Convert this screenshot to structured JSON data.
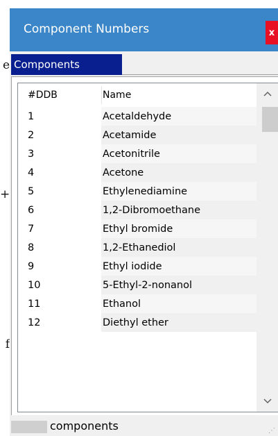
{
  "background_fragments": [
    "e",
    "+",
    "f"
  ],
  "window": {
    "title": "Component Numbers",
    "close_label": "x"
  },
  "tabs": [
    {
      "label": "Components",
      "selected": true
    }
  ],
  "table": {
    "columns": [
      "#DDB",
      "Name"
    ],
    "rows": [
      {
        "ddb": "1",
        "name": "Acetaldehyde"
      },
      {
        "ddb": "2",
        "name": "Acetamide"
      },
      {
        "ddb": "3",
        "name": "Acetonitrile"
      },
      {
        "ddb": "4",
        "name": "Acetone"
      },
      {
        "ddb": "5",
        "name": "Ethylenediamine"
      },
      {
        "ddb": "6",
        "name": "1,2-Dibromoethane"
      },
      {
        "ddb": "7",
        "name": "Ethyl bromide"
      },
      {
        "ddb": "8",
        "name": "1,2-Ethanediol"
      },
      {
        "ddb": "9",
        "name": "Ethyl iodide"
      },
      {
        "ddb": "10",
        "name": "5-Ethyl-2-nonanol"
      },
      {
        "ddb": "11",
        "name": "Ethanol"
      },
      {
        "ddb": "12",
        "name": "Diethyl ether"
      }
    ]
  },
  "scrollbar": {
    "up_icon": "chevron-up-icon",
    "down_icon": "chevron-down-icon"
  },
  "status": {
    "text": "components"
  },
  "colors": {
    "titlebar": "#3a86c8",
    "close": "#e81123",
    "tab_selected": "#0a1f8f"
  }
}
